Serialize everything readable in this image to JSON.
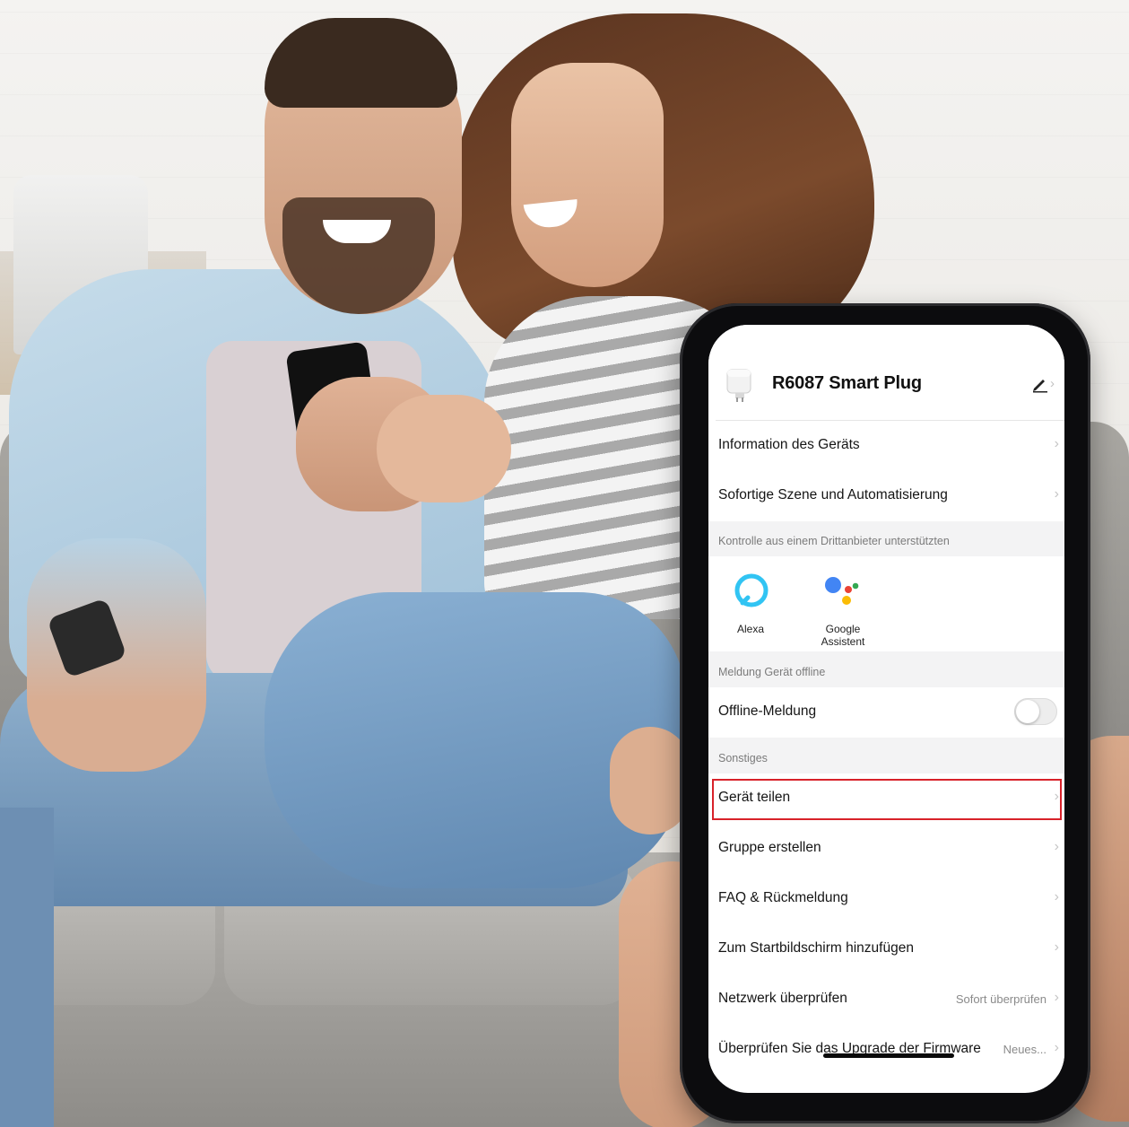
{
  "device": {
    "title": "R6087 Smart Plug",
    "icon": "smart-plug-icon"
  },
  "menu_top": [
    {
      "label": "Information des Geräts"
    },
    {
      "label": "Sofortige Szene und Automatisierung"
    }
  ],
  "third_party": {
    "section_label": "Kontrolle aus einem Drittanbieter unterstützten",
    "alexa_label": "Alexa",
    "google_label": "Google Assistent",
    "alexa_icon": "alexa-icon",
    "google_icon": "google-assistant-icon"
  },
  "offline": {
    "section_label": "Meldung Gerät offline",
    "label": "Offline-Meldung",
    "enabled": false
  },
  "misc": {
    "section_label": "Sonstiges",
    "items": [
      {
        "label": "Gerät teilen",
        "highlighted": true
      },
      {
        "label": "Gruppe erstellen"
      },
      {
        "label": "FAQ & Rückmeldung"
      },
      {
        "label": "Zum Startbildschirm hinzufügen"
      },
      {
        "label": "Netzwerk überprüfen",
        "value": "Sofort überprüfen"
      },
      {
        "label": "Überprüfen Sie das Upgrade der Firmware",
        "value": "Neues..."
      }
    ]
  },
  "colors": {
    "highlight": "#d8222a",
    "alexa": "#31c4f3",
    "google_blue": "#4285f4",
    "google_red": "#ea4335",
    "google_yellow": "#fbbc05",
    "google_green": "#34a853"
  }
}
